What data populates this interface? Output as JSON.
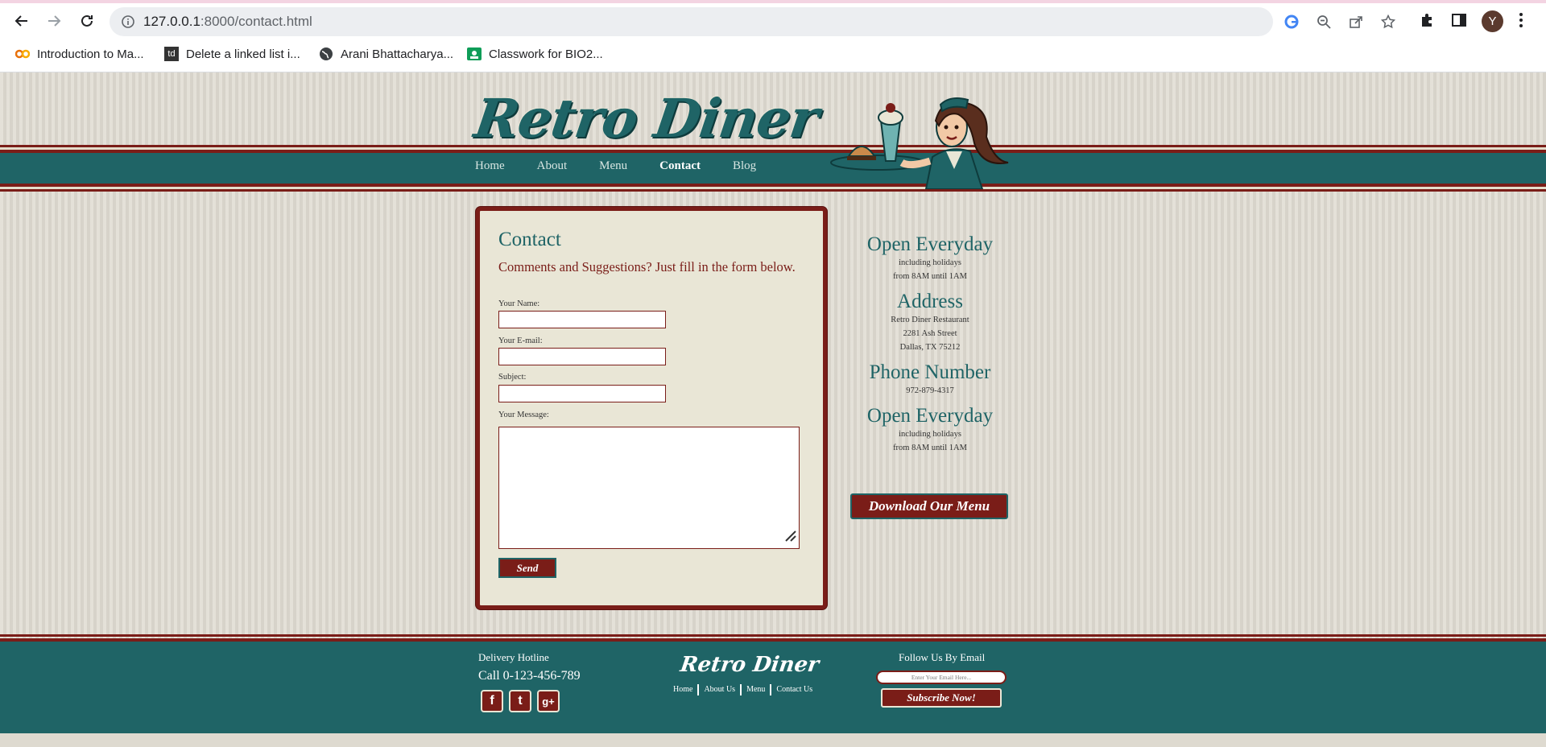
{
  "browser": {
    "url_host": "127.0.0.1",
    "url_path": ":8000/contact.html",
    "avatar_letter": "Y",
    "bookmarks": [
      {
        "label": "Introduction to Ma...",
        "icon": "colab-icon"
      },
      {
        "label": "Delete a linked list i...",
        "icon": "td-icon"
      },
      {
        "label": "Arani Bhattacharya...",
        "icon": "globe-icon"
      },
      {
        "label": "Classwork for BIO2...",
        "icon": "classroom-icon"
      }
    ]
  },
  "site": {
    "logo": "Retro Diner",
    "nav": [
      "Home",
      "About",
      "Menu",
      "Contact",
      "Blog"
    ],
    "active_nav": "Contact"
  },
  "contact": {
    "title": "Contact",
    "lead": "Comments and Suggestions? Just fill in the form below.",
    "fields": {
      "name_label": "Your Name:",
      "email_label": "Your E-mail:",
      "subject_label": "Subject:",
      "message_label": "Your Message:"
    },
    "send_label": "Send"
  },
  "sidebar": {
    "hours1_title": "Open Everyday",
    "hours1_line1": "including holidays",
    "hours1_line2": "from 8AM until 1AM",
    "address_title": "Address",
    "address_line1": "Retro Diner Restaurant",
    "address_line2": "2281 Ash Street",
    "address_line3": "Dallas, TX 75212",
    "phone_title": "Phone Number",
    "phone": "972-879-4317",
    "hours2_title": "Open Everyday",
    "hours2_line1": "including holidays",
    "hours2_line2": "from 8AM until 1AM",
    "download_label": "Download Our Menu"
  },
  "footer": {
    "hotline_label": "Delivery Hotline",
    "call": "Call 0-123-456-789",
    "logo": "Retro Diner",
    "links": [
      "Home",
      "About Us",
      "Menu",
      "Contact Us"
    ],
    "follow_label": "Follow Us By Email",
    "email_placeholder": "Enter Your Email Here...",
    "subscribe_label": "Subscribe Now!"
  },
  "colors": {
    "teal": "#1f6466",
    "maroon": "#7a1d18",
    "cream": "#e9e6d6"
  }
}
